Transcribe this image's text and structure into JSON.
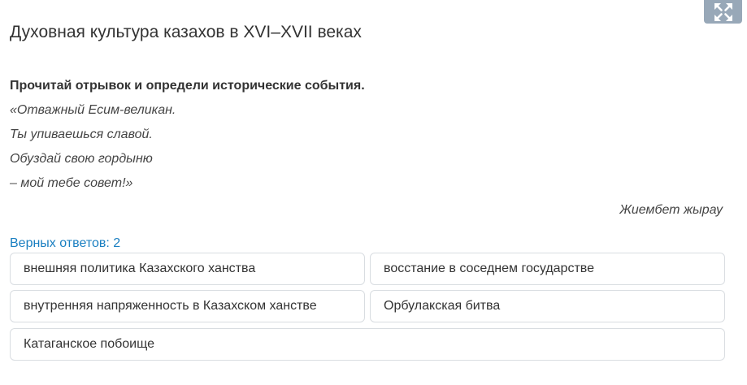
{
  "header": {
    "title": "Духовная культура казахов в XVI–XVII веках",
    "expand_icon": "expand-arrows-icon"
  },
  "question": {
    "instruction": "Прочитай отрывок и определи исторические события.",
    "poem": [
      "«Отважный Есим-великан.",
      "Ты упиваешься славой.",
      "Обуздай свою гордыню",
      "– мой тебе совет!»"
    ],
    "author": "Жиембет жырау"
  },
  "answers": {
    "correct_count_label": "Верных ответов: 2",
    "options": [
      "внешняя политика Казахского ханства",
      "восстание в соседнем государстве",
      "внутренняя напряженность в Казахском ханстве",
      "Орбулакская битва",
      "Катаганское побоище"
    ]
  },
  "colors": {
    "accent": "#1a7fc1",
    "expand_button_bg": "#98a8b8",
    "option_border": "#d9dde1"
  }
}
